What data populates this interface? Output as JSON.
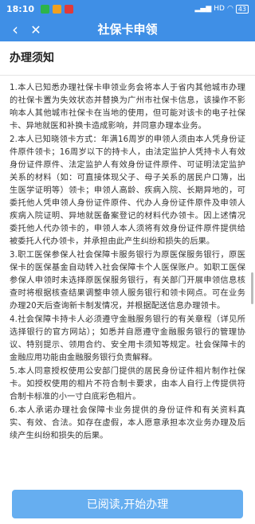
{
  "status_bar": {
    "time": "18:10",
    "network": "HD",
    "battery": "43"
  },
  "nav": {
    "back_glyph": "‹",
    "close_glyph": "✕",
    "title": "社保卡申领"
  },
  "notice": {
    "heading": "办理须知",
    "paragraphs": [
      "1.本人已知悉办理社保卡申领业务会将本人于省内其他城市办理的社保卡置为失效状态并替换为广州市社保卡信息，该操作不影响本人其他城市社保卡在当地的使用，但可能对该卡的电子社保卡、异地就医和补换卡造成影响，并同意办理本业务。",
      "2.本人已知晓领卡方式：年满16周岁的申领人须由本人凭身份证件原件领卡；16周岁以下的持卡人，由法定监护人凭持卡人有效身份证件原件、法定监护人有效身份证件原件、可证明法定监护关系的材料（如：可直接体现父子、母子关系的居民户口簿，出生医学证明等）领卡；申领人高龄、疾病入院、长期异地的，可委托他人凭申领人身份证件原件、代办人身份证件原件及申领人疾病入院证明、异地就医备案登记的材料代办领卡。因上述情况委托他人代办领卡的，申领人本人须将有效身份证件原件提供给被委托人代办领卡，并承担由此产生纠纷和损失的后果。",
      "3.职工医保参保人社会保障卡服务银行为原医保服务银行，原医保卡的医保基金自动转入社会保障卡个人医保账户。如职工医保参保人申领时未选择原医保服务银行，有关部门开展申领信息核查时将根据核查结果调整申领人服务银行和领卡网点。可在业务办理20天后查询新卡制发情况，并根据配送信息办理领卡。",
      "4.社会保障卡持卡人必须遵守金融服务银行的有关章程（详见所选择银行的官方网站）；如悉并自愿遵守金融服务银行的管理协议、特别提示、领用合约、安全用卡须知等规定。社会保障卡的金融应用功能由金融服务银行负责解释。",
      "5.本人同意授权使用公安部门提供的居民身份证件相片制作社保卡。如授权使用的相片不符合制卡要求，由本人自行上传提供符合制卡标准的小一寸白底彩色相片。",
      "6.本人承诺办理社会保障卡业务提供的身份证件和有关资料真实、有效、合法。如存在虚假，本人愿意承担本次业务办理及后续产生纠纷和损失的后果。"
    ]
  },
  "footer": {
    "confirm_label": "已阅读,开始办理"
  },
  "colors": {
    "header_blue": "#3f8fe6",
    "button_blue": "#66aef0"
  }
}
